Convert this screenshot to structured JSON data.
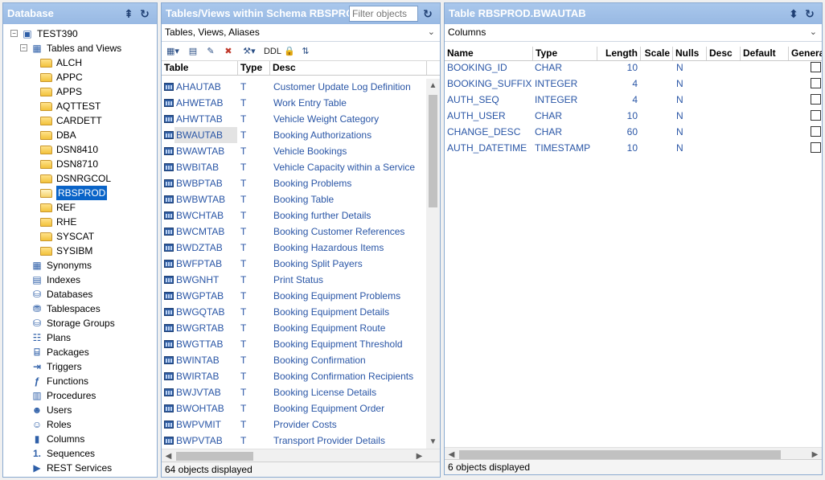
{
  "left": {
    "title": "Database",
    "tree": {
      "root": "TEST390",
      "tables_views": "Tables and Views",
      "schemas": [
        "ALCH",
        "APPC",
        "APPS",
        "AQTTEST",
        "CARDETT",
        "DBA",
        "DSN8410",
        "DSN8710",
        "DSNRGCOL",
        "RBSPROD",
        "REF",
        "RHE",
        "SYSCAT",
        "SYSIBM"
      ],
      "selected_schema": "RBSPROD",
      "items": [
        "Synonyms",
        "Indexes",
        "Databases",
        "Tablespaces",
        "Storage Groups",
        "Plans",
        "Packages",
        "Triggers",
        "Functions",
        "Procedures",
        "Users",
        "Roles",
        "Columns",
        "Sequences",
        "REST Services"
      ]
    }
  },
  "middle": {
    "title": "Tables/Views within Schema RBSPROD",
    "filter_placeholder": "Filter objects",
    "dropdown_value": "Tables, Views, Aliases",
    "toolbar_ddl": "DDL",
    "columns": {
      "table": "Table",
      "type": "Type",
      "desc": "Desc"
    },
    "selected_row": "BWAUTAB",
    "rows": [
      {
        "name": "AHAUTAB",
        "type": "T",
        "desc": "Customer Update Log Definition"
      },
      {
        "name": "AHWETAB",
        "type": "T",
        "desc": "Work Entry Table"
      },
      {
        "name": "AHWTTAB",
        "type": "T",
        "desc": "Vehicle Weight Category"
      },
      {
        "name": "BWAUTAB",
        "type": "T",
        "desc": "Booking Authorizations"
      },
      {
        "name": "BWAWTAB",
        "type": "T",
        "desc": "Vehicle Bookings"
      },
      {
        "name": "BWBITAB",
        "type": "T",
        "desc": "Vehicle Capacity within a Service"
      },
      {
        "name": "BWBPTAB",
        "type": "T",
        "desc": "Booking Problems"
      },
      {
        "name": "BWBWTAB",
        "type": "T",
        "desc": "Booking Table"
      },
      {
        "name": "BWCHTAB",
        "type": "T",
        "desc": "Booking further Details"
      },
      {
        "name": "BWCMTAB",
        "type": "T",
        "desc": "Booking Customer References"
      },
      {
        "name": "BWDZTAB",
        "type": "T",
        "desc": "Booking Hazardous Items"
      },
      {
        "name": "BWFPTAB",
        "type": "T",
        "desc": "Booking Split Payers"
      },
      {
        "name": "BWGNHT",
        "type": "T",
        "desc": "Print Status"
      },
      {
        "name": "BWGPTAB",
        "type": "T",
        "desc": "Booking Equipment Problems"
      },
      {
        "name": "BWGQTAB",
        "type": "T",
        "desc": "Booking Equipment Details"
      },
      {
        "name": "BWGRTAB",
        "type": "T",
        "desc": "Booking Equipment Route"
      },
      {
        "name": "BWGTTAB",
        "type": "T",
        "desc": "Booking Equipment Threshold"
      },
      {
        "name": "BWINTAB",
        "type": "T",
        "desc": "Booking Confirmation"
      },
      {
        "name": "BWIRTAB",
        "type": "T",
        "desc": "Booking Confirmation Recipients"
      },
      {
        "name": "BWJVTAB",
        "type": "T",
        "desc": "Booking License Details"
      },
      {
        "name": "BWOHTAB",
        "type": "T",
        "desc": "Booking Equipment Order"
      },
      {
        "name": "BWPVMIT",
        "type": "T",
        "desc": "Provider Costs"
      },
      {
        "name": "BWPVTAB",
        "type": "T",
        "desc": "Transport Provider Details"
      }
    ],
    "status": "64 objects displayed"
  },
  "right": {
    "title": "Table RBSPROD.BWAUTAB",
    "dropdown_value": "Columns",
    "columns": {
      "name": "Name",
      "type": "Type",
      "length": "Length",
      "scale": "Scale",
      "nulls": "Nulls",
      "desc": "Desc",
      "default": "Default",
      "generated": "Genera"
    },
    "rows": [
      {
        "name": "BOOKING_ID",
        "type": "CHAR",
        "length": "10",
        "scale": "",
        "nulls": "N"
      },
      {
        "name": "BOOKING_SUFFIX",
        "type": "INTEGER",
        "length": "4",
        "scale": "",
        "nulls": "N"
      },
      {
        "name": "AUTH_SEQ",
        "type": "INTEGER",
        "length": "4",
        "scale": "",
        "nulls": "N"
      },
      {
        "name": "AUTH_USER",
        "type": "CHAR",
        "length": "10",
        "scale": "",
        "nulls": "N"
      },
      {
        "name": "CHANGE_DESC",
        "type": "CHAR",
        "length": "60",
        "scale": "",
        "nulls": "N"
      },
      {
        "name": "AUTH_DATETIME",
        "type": "TIMESTAMP",
        "length": "10",
        "scale": "",
        "nulls": "N"
      }
    ],
    "status": "6 objects displayed"
  }
}
